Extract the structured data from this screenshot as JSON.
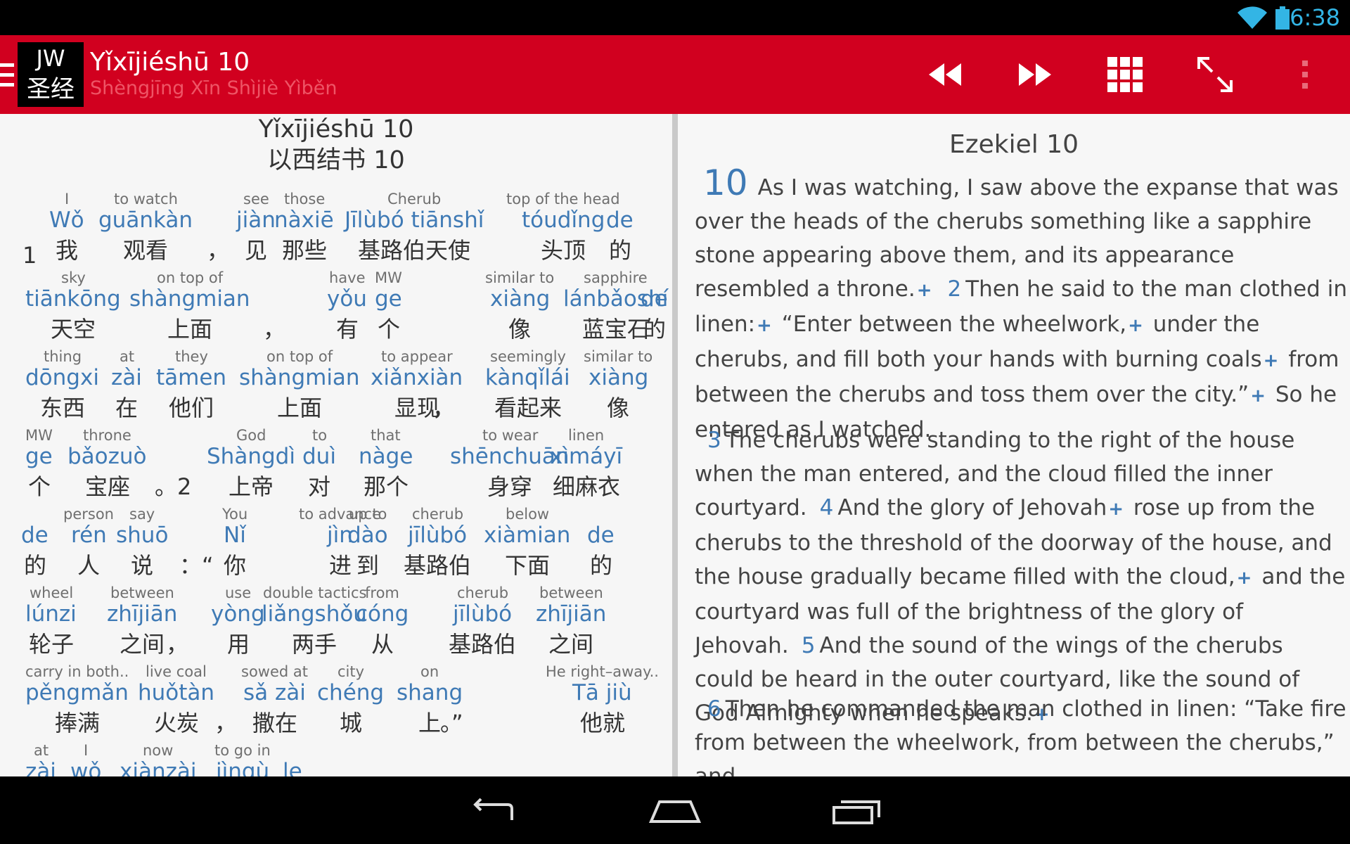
{
  "status_bar": {
    "time": "6:38",
    "icons": [
      "wifi-icon",
      "battery-icon"
    ],
    "accent_color": "#33b5e5"
  },
  "app_bar": {
    "color": "#d1001f",
    "logo": {
      "line1": "JW",
      "line2": "圣经"
    },
    "title": "Yǐxījiéshū 10",
    "subtitle": "Shèngjīng Xīn Shìjiè Yìběn",
    "actions": [
      "rewind-icon",
      "fast-forward-icon",
      "grid-icon",
      "expand-icon",
      "overflow-menu-icon"
    ]
  },
  "left_pane": {
    "title_pinyin": "Yǐxījiéshū 10",
    "title_chinese": "以西结书 10",
    "lines": [
      [
        {
          "e": "I",
          "p": "Wǒ",
          "h": "我"
        },
        {
          "e": "to watch",
          "p": "guānkàn",
          "h": "观看"
        },
        {
          "h": "，"
        },
        {
          "e": "see",
          "p": "jiàn",
          "h": "见"
        },
        {
          "e": "those",
          "p": "nàxiē",
          "h": "那些"
        },
        {
          "e": "Cherub",
          "p": "Jīlùbó tiānshǐ",
          "h": "基路伯天使"
        },
        {
          "e": "top of the head",
          "p": "tóudǐng",
          "h": "头顶"
        },
        {
          "p": "de",
          "h": "的"
        }
      ],
      [
        {
          "e": "sky",
          "p": "tiānkōng",
          "h": "天空"
        },
        {
          "e": "on top of",
          "p": "shàngmian",
          "h": "上面"
        },
        {
          "h": "，"
        },
        {
          "e": "have",
          "p": "yǒu",
          "h": "有"
        },
        {
          "e": "MW",
          "p": "ge",
          "h": "个"
        },
        {
          "e": "similar to",
          "p": "xiàng",
          "h": "像"
        },
        {
          "e": "sapphire",
          "p": "lánbǎoshí",
          "h": "蓝宝石"
        },
        {
          "p": "de",
          "h": "的"
        }
      ],
      [
        {
          "e": "thing",
          "p": "dōngxi",
          "h": "东西"
        },
        {
          "e": "at",
          "p": "zài",
          "h": "在"
        },
        {
          "e": "they",
          "p": "tāmen",
          "h": "他们"
        },
        {
          "e": "on top of",
          "p": "shàngmian",
          "h": "上面"
        },
        {
          "e": "to appear",
          "p": "xiǎnxiàn",
          "h": "显现"
        },
        {
          "h": "，"
        },
        {
          "e": "seemingly",
          "p": "kànqǐlái",
          "h": "看起来"
        },
        {
          "e": "similar to",
          "p": "xiàng",
          "h": "像"
        }
      ],
      [
        {
          "e": "MW",
          "p": "ge",
          "h": "个"
        },
        {
          "e": "throne",
          "p": "bǎozuò",
          "h": "宝座"
        },
        {
          "h": "。2"
        },
        {
          "e": "God",
          "p": "Shàngdì",
          "h": "上帝"
        },
        {
          "e": "to",
          "p": "duì",
          "h": "对"
        },
        {
          "e": "that",
          "p": "nàge",
          "h": "那个"
        },
        {
          "e": "to wear",
          "p": "shēnchuān",
          "h": "身穿"
        },
        {
          "e": "linen",
          "p": "xìmáyī",
          "h": "细麻衣"
        }
      ],
      [
        {
          "p": "de",
          "h": "的"
        },
        {
          "e": "person",
          "p": "rén",
          "h": "人"
        },
        {
          "e": "say",
          "p": "shuō",
          "h": "说"
        },
        {
          "h": "：“"
        },
        {
          "e": "You",
          "p": "Nǐ",
          "h": "你"
        },
        {
          "e": "to advance",
          "p": "jìn",
          "h": "进"
        },
        {
          "e": "up to",
          "p": "dào",
          "h": "到"
        },
        {
          "e": "cherub",
          "p": "jīlùbó",
          "h": "基路伯"
        },
        {
          "e": "below",
          "p": "xiàmian",
          "h": "下面"
        },
        {
          "p": "de",
          "h": "的"
        }
      ],
      [
        {
          "e": "wheel",
          "p": "lúnzi",
          "h": "轮子"
        },
        {
          "e": "between",
          "p": "zhījiān",
          "h": "之间"
        },
        {
          "h": "，"
        },
        {
          "e": "use",
          "p": "yòng",
          "h": "用"
        },
        {
          "e": "double tactics",
          "p": "liǎngshǒu",
          "h": "两手"
        },
        {
          "e": "from",
          "p": "cóng",
          "h": "从"
        },
        {
          "e": "cherub",
          "p": "jīlùbó",
          "h": "基路伯"
        },
        {
          "e": "between",
          "p": "zhījiān",
          "h": "之间"
        }
      ],
      [
        {
          "e": "carry in both..",
          "p": "pěngmǎn",
          "h": "捧满"
        },
        {
          "e": "live coal",
          "p": "huǒtàn",
          "h": "火炭"
        },
        {
          "h": "，"
        },
        {
          "e": "sowed at",
          "p": "sǎ zài",
          "h": "撒在"
        },
        {
          "e": "city",
          "p": "chéng",
          "h": "城"
        },
        {
          "e": "on",
          "p": "shang",
          "h": "上"
        },
        {
          "h": "。”"
        },
        {
          "e": "He right–away..",
          "p": "Tā jiù",
          "h": "他就"
        }
      ],
      [
        {
          "e": "at",
          "p": "zài"
        },
        {
          "e": "I",
          "p": "wǒ"
        },
        {
          "e": "now",
          "p": "xiànzài"
        },
        {
          "e": "to go in",
          "p": "jìnqù"
        },
        {
          "p": "le"
        }
      ]
    ]
  },
  "right_pane": {
    "title": "Ezekiel 10",
    "chapter_number": "10",
    "paragraphs": [
      {
        "segments": [
          {
            "t": "As I was watching, I saw above the expanse that was over the heads of the cherubs something like a sapphire stone appearing above them, and its appearance resembled a throne."
          },
          {
            "plus": "+"
          },
          {
            "v": "2"
          },
          {
            "t": "Then he said to the man clothed in linen:"
          },
          {
            "plus": "+"
          },
          {
            "t": " “Enter between the wheelwork,"
          },
          {
            "plus": "+"
          },
          {
            "t": " under the cherubs, and fill both your hands with burning coals"
          },
          {
            "plus": "+"
          },
          {
            "t": " from between the cherubs and toss them over the city.”"
          },
          {
            "plus": "+"
          },
          {
            "t": " So he entered as I watched."
          }
        ]
      },
      {
        "segments": [
          {
            "v": "3"
          },
          {
            "t": "The cherubs were standing to the right of the house when the man entered, and the cloud filled the inner courtyard."
          },
          {
            "v": "4"
          },
          {
            "t": "And the glory of Jehovah"
          },
          {
            "plus": "+"
          },
          {
            "t": " rose up from the cherubs to the threshold of the doorway of the house, and the house gradually became filled with the cloud,"
          },
          {
            "plus": "+"
          },
          {
            "t": " and the courtyard was full of the brightness of the glory of Jehovah."
          },
          {
            "v": "5"
          },
          {
            "t": "And the sound of the wings of the cherubs could be heard in the outer courtyard, like the sound of God Almighty when he speaks."
          },
          {
            "plus": "+"
          }
        ]
      },
      {
        "segments": [
          {
            "v": "6"
          },
          {
            "t": "Then he commanded the man clothed in linen: “Take fire from between the wheelwork, from between the cherubs,” and"
          }
        ]
      }
    ]
  },
  "nav_bar": {
    "buttons": [
      "back-icon",
      "home-icon",
      "recent-apps-icon"
    ]
  }
}
